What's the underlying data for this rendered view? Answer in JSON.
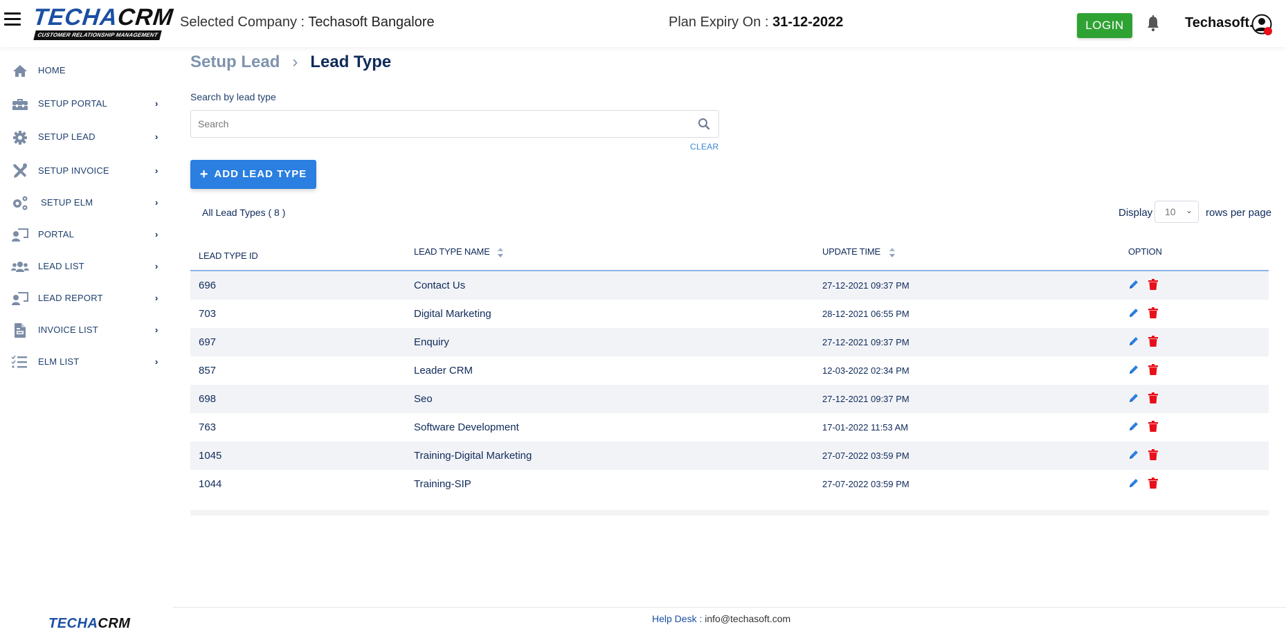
{
  "header": {
    "company_label": "Selected Company :",
    "company_name": "Techasoft Bangalore",
    "plan_label": "Plan Expiry On :",
    "plan_date": "31-12-2022",
    "login_label": "LOGIN",
    "username": "Techasoft.",
    "logo_main_a": "TECHA",
    "logo_main_b": "CRM",
    "logo_sub": "CUSTOMER RELATIONSHIP MANAGEMENT"
  },
  "sidebar": {
    "items": [
      {
        "label": "HOME",
        "icon": "home-icon",
        "has_children": false
      },
      {
        "label": "SETUP PORTAL",
        "icon": "toolbox-icon",
        "has_children": true
      },
      {
        "label": "SETUP LEAD",
        "icon": "gear-icon",
        "has_children": true
      },
      {
        "label": "SETUP INVOICE",
        "icon": "tools-icon",
        "has_children": true
      },
      {
        "label": "SETUP ELM",
        "icon": "gears-icon",
        "has_children": true
      },
      {
        "label": "PORTAL",
        "icon": "presenter-icon",
        "has_children": true
      },
      {
        "label": "LEAD LIST",
        "icon": "users-icon",
        "has_children": true
      },
      {
        "label": "LEAD REPORT",
        "icon": "presenter-icon",
        "has_children": true
      },
      {
        "label": "INVOICE LIST",
        "icon": "document-icon",
        "has_children": true
      },
      {
        "label": "ELM LIST",
        "icon": "checklist-icon",
        "has_children": true
      }
    ],
    "chevron": "›",
    "footer_logo_a": "TECHA",
    "footer_logo_b": "CRM"
  },
  "breadcrumb": {
    "parent": "Setup Lead",
    "separator": "›",
    "current": "Lead Type"
  },
  "search": {
    "label": "Search by lead type",
    "placeholder": "Search",
    "value": "",
    "clear_label": "CLEAR"
  },
  "actions": {
    "add_label": "ADD LEAD TYPE",
    "add_icon": "+"
  },
  "list": {
    "count_label": "All Lead Types ( 8 )",
    "display_label": "Display",
    "rows_per_page": "10",
    "rows_suffix": "rows per page"
  },
  "table": {
    "columns": [
      "LEAD TYPE ID",
      "LEAD TYPE NAME",
      "UPDATE TIME",
      "OPTION"
    ],
    "rows": [
      {
        "id": "696",
        "name": "Contact Us",
        "time": "27-12-2021 09:37 PM"
      },
      {
        "id": "703",
        "name": "Digital Marketing",
        "time": "28-12-2021 06:55 PM"
      },
      {
        "id": "697",
        "name": "Enquiry",
        "time": "27-12-2021 09:37 PM"
      },
      {
        "id": "857",
        "name": "Leader CRM",
        "time": "12-03-2022 02:34 PM"
      },
      {
        "id": "698",
        "name": "Seo",
        "time": "27-12-2021 09:37 PM"
      },
      {
        "id": "763",
        "name": "Software Development",
        "time": "17-01-2022 11:53 AM"
      },
      {
        "id": "1045",
        "name": "Training-Digital Marketing",
        "time": "27-07-2022 03:59 PM"
      },
      {
        "id": "1044",
        "name": "Training-SIP",
        "time": "27-07-2022 03:59 PM"
      }
    ]
  },
  "footer": {
    "helpdesk_label": "Help Desk :",
    "helpdesk_email": "info@techasoft.com"
  },
  "colors": {
    "primary": "#2a7fe0",
    "login": "#2fa234",
    "navy": "#0f2a5a",
    "delete": "#e8101a",
    "row_alt": "#f2f3f7"
  }
}
